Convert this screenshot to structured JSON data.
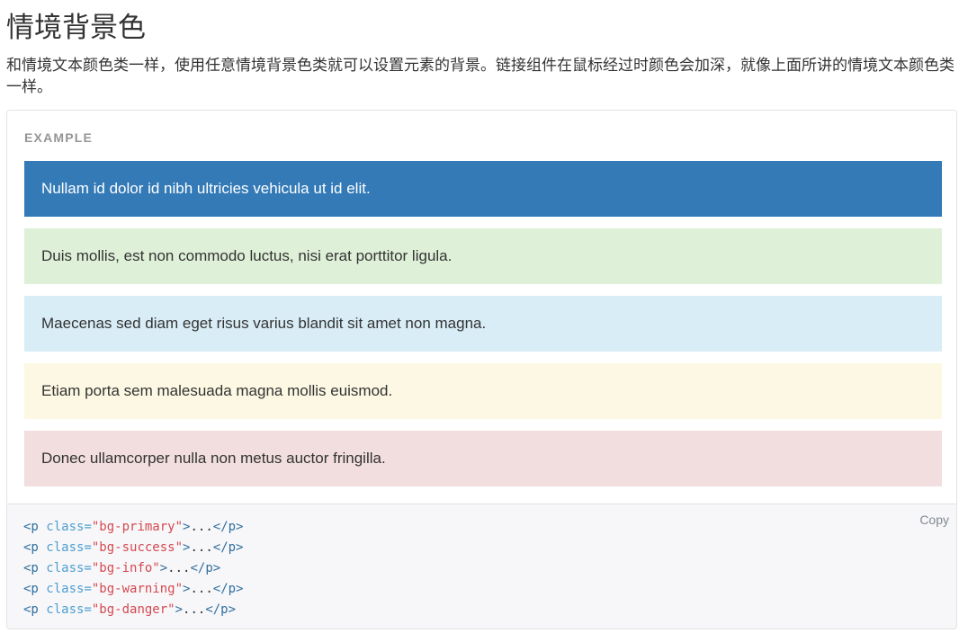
{
  "title": "情境背景色",
  "description": "和情境文本颜色类一样，使用任意情境背景色类就可以设置元素的背景。链接组件在鼠标经过时颜色会加深，就像上面所讲的情境文本颜色类一样。",
  "example": {
    "label": "EXAMPLE",
    "items": [
      {
        "text": "Nullam id dolor id nibh ultricies vehicula ut id elit."
      },
      {
        "text": "Duis mollis, est non commodo luctus, nisi erat porttitor ligula."
      },
      {
        "text": "Maecenas sed diam eget risus varius blandit sit amet non magna."
      },
      {
        "text": "Etiam porta sem malesuada magna mollis euismod."
      },
      {
        "text": "Donec ullamcorper nulla non metus auctor fringilla."
      }
    ]
  },
  "code": {
    "copy_label": "Copy",
    "lines": [
      {
        "open": "<p",
        "attr": " class=",
        "value": "\"bg-primary\"",
        "close": ">",
        "body": "...",
        "end": "</p>"
      },
      {
        "open": "<p",
        "attr": " class=",
        "value": "\"bg-success\"",
        "close": ">",
        "body": "...",
        "end": "</p>"
      },
      {
        "open": "<p",
        "attr": " class=",
        "value": "\"bg-info\"",
        "close": ">",
        "body": "...",
        "end": "</p>"
      },
      {
        "open": "<p",
        "attr": " class=",
        "value": "\"bg-warning\"",
        "close": ">",
        "body": "...",
        "end": "</p>"
      },
      {
        "open": "<p",
        "attr": " class=",
        "value": "\"bg-danger\"",
        "close": ">",
        "body": "...",
        "end": "</p>"
      }
    ]
  },
  "colors": {
    "primary": "#337ab7",
    "success": "#dff0d8",
    "info": "#d9edf7",
    "warning": "#fcf8e3",
    "danger": "#f2dede"
  }
}
